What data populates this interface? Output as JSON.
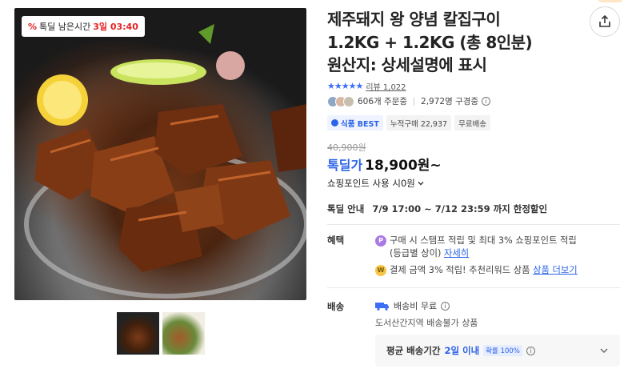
{
  "product": {
    "title_line1": "제주돼지 왕 양념 칼집구이",
    "title_line2": "1.2KG + 1.2KG (총 8인분)",
    "title_line3": "원산지: 상세설명에 표시",
    "timer_badge": {
      "icon": "%",
      "label": "톡딜 남은시간",
      "remaining": "3일 03:40"
    },
    "rating": {
      "stars": "★★★★★",
      "review_label": "리뷰",
      "review_count": "1,022"
    },
    "stats": {
      "orders": "606개 주문중",
      "subscribers": "2,972명 구경중"
    },
    "tags": {
      "best": "식품 BEST",
      "cumulative": "누적구매 22,937",
      "free_shipping": "무료배송"
    },
    "price": {
      "original": "40,900원",
      "deal_label": "톡딜가",
      "deal_price": "18,900원~",
      "points": "쇼핑포인트 사용 시0원"
    },
    "deal_info": {
      "label": "톡딜 안내",
      "period": "7/9 17:00 ~ 7/12 23:59 까지 한정할인"
    },
    "benefits": {
      "label": "혜택",
      "item1_line1": "구매 시 스탬프 적립 및 최대 3% 쇼핑포인트 적립",
      "item1_line2": "(등급별 상이)",
      "item1_link": "자세히",
      "item2_text": "결제 금액 3% 적립! 추천리워드 상품",
      "item2_link": "상품 더보기",
      "coin1": "P",
      "coin2": "W"
    },
    "shipping": {
      "label": "배송",
      "fee": "배송비 무료",
      "note": "도서산간지역 배송불가 상품",
      "avg_label": "평균 배송기간",
      "avg_value": "2일 이내",
      "avg_badge": "확률 100%"
    }
  },
  "icons": {
    "share": "share-icon",
    "info": "info-icon",
    "truck": "truck-icon",
    "chevron": "chevron-down-icon"
  },
  "colors": {
    "accent": "#2b63e8",
    "badge_red": "#e52222"
  }
}
